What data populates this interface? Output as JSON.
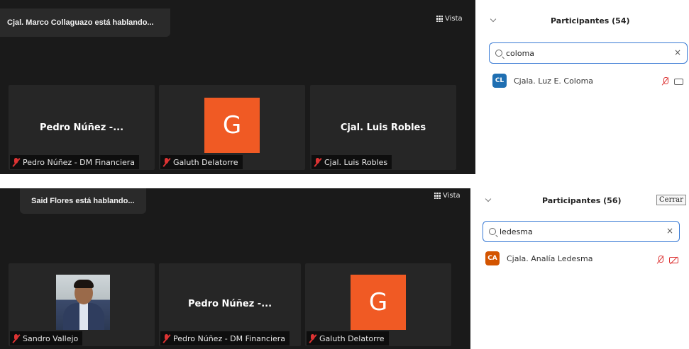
{
  "top": {
    "speaker_banner": "Cjal. Marco Collaguazo está hablando...",
    "view_label": "Vista",
    "tiles": [
      {
        "big_name": "Pedro Núñez -...",
        "label": "Pedro Núñez - DM Financiera"
      },
      {
        "avatar_letter": "G",
        "label": "Galuth Delatorre"
      },
      {
        "big_name": "Cjal. Luis Robles",
        "label": "Cjal. Luis Robles"
      }
    ],
    "panel": {
      "title": "Participantes (54)",
      "search_value": "coloma",
      "clear_symbol": "×",
      "participants": [
        {
          "initials": "CL",
          "name": "Cjala. Luz E. Coloma",
          "initials_color": "#1f6fb2"
        }
      ]
    }
  },
  "bottom": {
    "speaker_banner": "Said Flores está hablando...",
    "view_label": "Vista",
    "tiles": [
      {
        "photo": true,
        "label": "Sandro Vallejo"
      },
      {
        "big_name": "Pedro Núñez -...",
        "label": "Pedro Núñez - DM Financiera"
      },
      {
        "avatar_letter": "G",
        "label": "Galuth Delatorre"
      }
    ],
    "panel": {
      "title": "Participantes (56)",
      "close_label": "Cerrar",
      "search_value": "ledesma",
      "clear_symbol": "×",
      "participants": [
        {
          "initials": "CA",
          "name": "Cjala. Analía Ledesma",
          "initials_color": "#d35400"
        }
      ]
    }
  },
  "colors": {
    "avatar_orange": "#f05a24",
    "search_border": "#3a7bd5",
    "muted_red": "#dd3333"
  }
}
